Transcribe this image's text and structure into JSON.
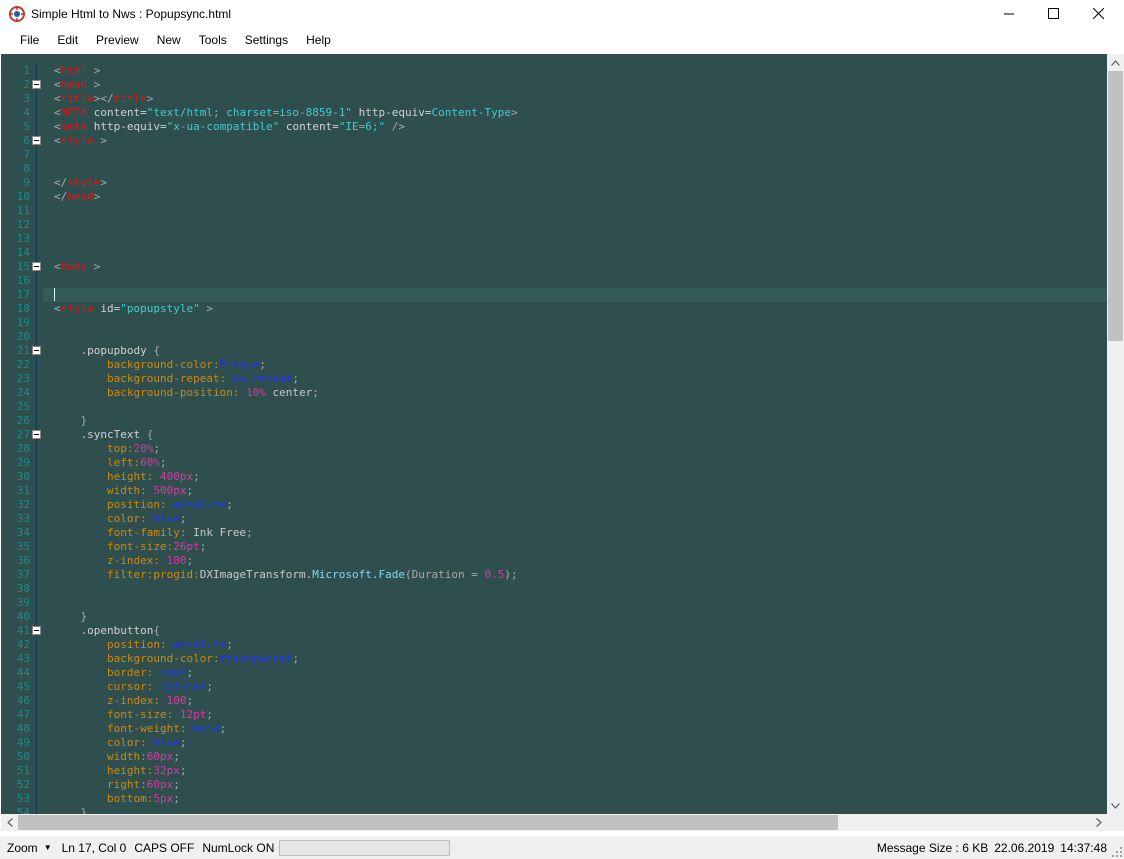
{
  "window": {
    "title": "Simple Html to Nws : Popupsync.html"
  },
  "menu": [
    "File",
    "Edit",
    "Preview",
    "New",
    "Tools",
    "Settings",
    "Help"
  ],
  "editor": {
    "current_line": 17,
    "lines": [
      {
        "n": "1",
        "fold": false,
        "tokens": [
          [
            "pun",
            "<"
          ],
          [
            "tag",
            "html"
          ],
          [
            "pun",
            " >"
          ]
        ]
      },
      {
        "n": "2",
        "fold": true,
        "tokens": [
          [
            "pun",
            "<"
          ],
          [
            "tag",
            "head"
          ],
          [
            "pun",
            " >"
          ]
        ]
      },
      {
        "n": "3",
        "fold": false,
        "tokens": [
          [
            "pun",
            "<"
          ],
          [
            "tag",
            "title"
          ],
          [
            "pun",
            "></"
          ],
          [
            "tag",
            "title"
          ],
          [
            "pun",
            ">"
          ]
        ]
      },
      {
        "n": "4",
        "fold": false,
        "tokens": [
          [
            "pun",
            "<"
          ],
          [
            "tag",
            "META"
          ],
          [
            "att",
            " content="
          ],
          [
            "str",
            "\"text/html; charset=iso-8859-1\""
          ],
          [
            "att",
            " http-equiv="
          ],
          [
            "str",
            "Content-Type"
          ],
          [
            "pun",
            ">"
          ]
        ]
      },
      {
        "n": "5",
        "fold": false,
        "tokens": [
          [
            "pun",
            "<"
          ],
          [
            "tag",
            "meta"
          ],
          [
            "att",
            " http-equiv="
          ],
          [
            "str",
            "\"x-ua-compatible\""
          ],
          [
            "att",
            " content="
          ],
          [
            "str",
            "\"IE=6;\""
          ],
          [
            "pun",
            " />"
          ]
        ]
      },
      {
        "n": "6",
        "fold": true,
        "tokens": [
          [
            "pun",
            "<"
          ],
          [
            "tag",
            "style"
          ],
          [
            "pun",
            " >"
          ]
        ]
      },
      {
        "n": "7",
        "fold": false,
        "tokens": []
      },
      {
        "n": "8",
        "fold": false,
        "tokens": []
      },
      {
        "n": "9",
        "fold": false,
        "tokens": [
          [
            "pun",
            "</"
          ],
          [
            "tag",
            "style"
          ],
          [
            "pun",
            ">"
          ]
        ]
      },
      {
        "n": "10",
        "fold": false,
        "tokens": [
          [
            "pun",
            "</"
          ],
          [
            "tag",
            "head"
          ],
          [
            "pun",
            ">"
          ]
        ]
      },
      {
        "n": "11",
        "fold": false,
        "tokens": []
      },
      {
        "n": "12",
        "fold": false,
        "tokens": []
      },
      {
        "n": "13",
        "fold": false,
        "tokens": []
      },
      {
        "n": "14",
        "fold": false,
        "tokens": []
      },
      {
        "n": "15",
        "fold": true,
        "tokens": [
          [
            "pun",
            "<"
          ],
          [
            "tag",
            "body"
          ],
          [
            "pun",
            " >"
          ]
        ]
      },
      {
        "n": "16",
        "fold": false,
        "tokens": []
      },
      {
        "n": "17",
        "fold": false,
        "tokens": []
      },
      {
        "n": "18",
        "fold": false,
        "tokens": [
          [
            "pun",
            "<"
          ],
          [
            "tag",
            "style"
          ],
          [
            "att",
            " id="
          ],
          [
            "str",
            "\"popupstyle\""
          ],
          [
            "pun",
            " >"
          ]
        ]
      },
      {
        "n": "19",
        "fold": false,
        "tokens": []
      },
      {
        "n": "20",
        "fold": false,
        "tokens": []
      },
      {
        "n": "21",
        "fold": true,
        "tokens": [
          [
            "sel",
            "    .popupbody "
          ],
          [
            "pun",
            "{"
          ]
        ]
      },
      {
        "n": "22",
        "fold": false,
        "tokens": [
          [
            "prop",
            "        background-color:"
          ],
          [
            "kw",
            "Bisque"
          ],
          [
            "pun",
            ";"
          ]
        ]
      },
      {
        "n": "23",
        "fold": false,
        "tokens": [
          [
            "prop",
            "        background-repeat: "
          ],
          [
            "kw",
            "no-repeat"
          ],
          [
            "pun",
            ";"
          ]
        ]
      },
      {
        "n": "24",
        "fold": false,
        "tokens": [
          [
            "prop",
            "        background-position: "
          ],
          [
            "num",
            "10%"
          ],
          [
            "txt",
            " center"
          ],
          [
            "pun",
            ";"
          ]
        ]
      },
      {
        "n": "25",
        "fold": false,
        "tokens": []
      },
      {
        "n": "26",
        "fold": false,
        "tokens": [
          [
            "pun",
            "    }"
          ]
        ]
      },
      {
        "n": "27",
        "fold": true,
        "tokens": [
          [
            "sel",
            "    .syncText "
          ],
          [
            "pun",
            "{"
          ]
        ]
      },
      {
        "n": "28",
        "fold": false,
        "tokens": [
          [
            "prop",
            "        top:"
          ],
          [
            "num",
            "20%"
          ],
          [
            "pun",
            ";"
          ]
        ]
      },
      {
        "n": "29",
        "fold": false,
        "tokens": [
          [
            "prop",
            "        left:"
          ],
          [
            "num",
            "60%"
          ],
          [
            "pun",
            ";"
          ]
        ]
      },
      {
        "n": "30",
        "fold": false,
        "tokens": [
          [
            "prop",
            "        height: "
          ],
          [
            "num",
            "400px"
          ],
          [
            "pun",
            ";"
          ]
        ]
      },
      {
        "n": "31",
        "fold": false,
        "tokens": [
          [
            "prop",
            "        width: "
          ],
          [
            "num",
            "500px"
          ],
          [
            "pun",
            ";"
          ]
        ]
      },
      {
        "n": "32",
        "fold": false,
        "tokens": [
          [
            "prop",
            "        position: "
          ],
          [
            "kw",
            "absolute"
          ],
          [
            "pun",
            ";"
          ]
        ]
      },
      {
        "n": "33",
        "fold": false,
        "tokens": [
          [
            "prop",
            "        color: "
          ],
          [
            "kw",
            "blue"
          ],
          [
            "pun",
            ";"
          ]
        ]
      },
      {
        "n": "34",
        "fold": false,
        "tokens": [
          [
            "prop",
            "        font-family: "
          ],
          [
            "txt",
            "Ink Free"
          ],
          [
            "pun",
            ";"
          ]
        ]
      },
      {
        "n": "35",
        "fold": false,
        "tokens": [
          [
            "prop",
            "        font-size:"
          ],
          [
            "num",
            "26pt"
          ],
          [
            "pun",
            ";"
          ]
        ]
      },
      {
        "n": "36",
        "fold": false,
        "tokens": [
          [
            "prop",
            "        z-index: "
          ],
          [
            "num",
            "100"
          ],
          [
            "pun",
            ";"
          ]
        ]
      },
      {
        "n": "37",
        "fold": false,
        "tokens": [
          [
            "prop",
            "        filter:progid:"
          ],
          [
            "txt",
            "DXImageTransform."
          ],
          [
            "fn",
            "Microsoft.Fade"
          ],
          [
            "pun",
            "(Duration = "
          ],
          [
            "num",
            "0.5"
          ],
          [
            "pun",
            ");"
          ]
        ]
      },
      {
        "n": "38",
        "fold": false,
        "tokens": []
      },
      {
        "n": "39",
        "fold": false,
        "tokens": []
      },
      {
        "n": "40",
        "fold": false,
        "tokens": [
          [
            "pun",
            "    }"
          ]
        ]
      },
      {
        "n": "41",
        "fold": true,
        "tokens": [
          [
            "sel",
            "    .openbutton"
          ],
          [
            "pun",
            "{"
          ]
        ]
      },
      {
        "n": "42",
        "fold": false,
        "tokens": [
          [
            "prop",
            "        position: "
          ],
          [
            "kw",
            "absolute"
          ],
          [
            "pun",
            ";"
          ]
        ]
      },
      {
        "n": "43",
        "fold": false,
        "tokens": [
          [
            "prop",
            "        background-color:"
          ],
          [
            "kw",
            "transparent"
          ],
          [
            "pun",
            ";"
          ]
        ]
      },
      {
        "n": "44",
        "fold": false,
        "tokens": [
          [
            "prop",
            "        border: "
          ],
          [
            "kw",
            "none"
          ],
          [
            "pun",
            ";"
          ]
        ]
      },
      {
        "n": "45",
        "fold": false,
        "tokens": [
          [
            "prop",
            "        cursor: "
          ],
          [
            "kw",
            "pointer"
          ],
          [
            "pun",
            ";"
          ]
        ]
      },
      {
        "n": "46",
        "fold": false,
        "tokens": [
          [
            "prop",
            "        z-index: "
          ],
          [
            "num",
            "100"
          ],
          [
            "pun",
            ";"
          ]
        ]
      },
      {
        "n": "47",
        "fold": false,
        "tokens": [
          [
            "prop",
            "        font-size: "
          ],
          [
            "num",
            "12pt"
          ],
          [
            "pun",
            ";"
          ]
        ]
      },
      {
        "n": "48",
        "fold": false,
        "tokens": [
          [
            "prop",
            "        font-weight: "
          ],
          [
            "kw",
            "bold"
          ],
          [
            "pun",
            ";"
          ]
        ]
      },
      {
        "n": "49",
        "fold": false,
        "tokens": [
          [
            "prop",
            "        color: "
          ],
          [
            "kw",
            "blue"
          ],
          [
            "pun",
            ";"
          ]
        ]
      },
      {
        "n": "50",
        "fold": false,
        "tokens": [
          [
            "prop",
            "        width:"
          ],
          [
            "num",
            "60px"
          ],
          [
            "pun",
            ";"
          ]
        ]
      },
      {
        "n": "51",
        "fold": false,
        "tokens": [
          [
            "prop",
            "        height:"
          ],
          [
            "num",
            "32px"
          ],
          [
            "pun",
            ";"
          ]
        ]
      },
      {
        "n": "52",
        "fold": false,
        "tokens": [
          [
            "prop",
            "        right:"
          ],
          [
            "num",
            "60px"
          ],
          [
            "pun",
            ";"
          ]
        ]
      },
      {
        "n": "53",
        "fold": false,
        "tokens": [
          [
            "prop",
            "        bottom:"
          ],
          [
            "num",
            "5px"
          ],
          [
            "pun",
            ";"
          ]
        ]
      },
      {
        "n": "54",
        "fold": false,
        "tokens": [
          [
            "pun",
            "    }"
          ]
        ]
      }
    ]
  },
  "statusbar": {
    "zoom_label": "Zoom",
    "position": "Ln 17, Col 0",
    "caps": "CAPS OFF",
    "numlock": "NumLock ON",
    "message_size": "Message Size :  6 KB",
    "date": "22.06.2019",
    "time": "14:37:48"
  },
  "colors": {
    "editor_bg": "#2f4f4f",
    "tag": "#d11b1b",
    "string": "#47c9c9",
    "property": "#c98a16",
    "number": "#d63aa0",
    "keyword": "#1f34d6"
  }
}
